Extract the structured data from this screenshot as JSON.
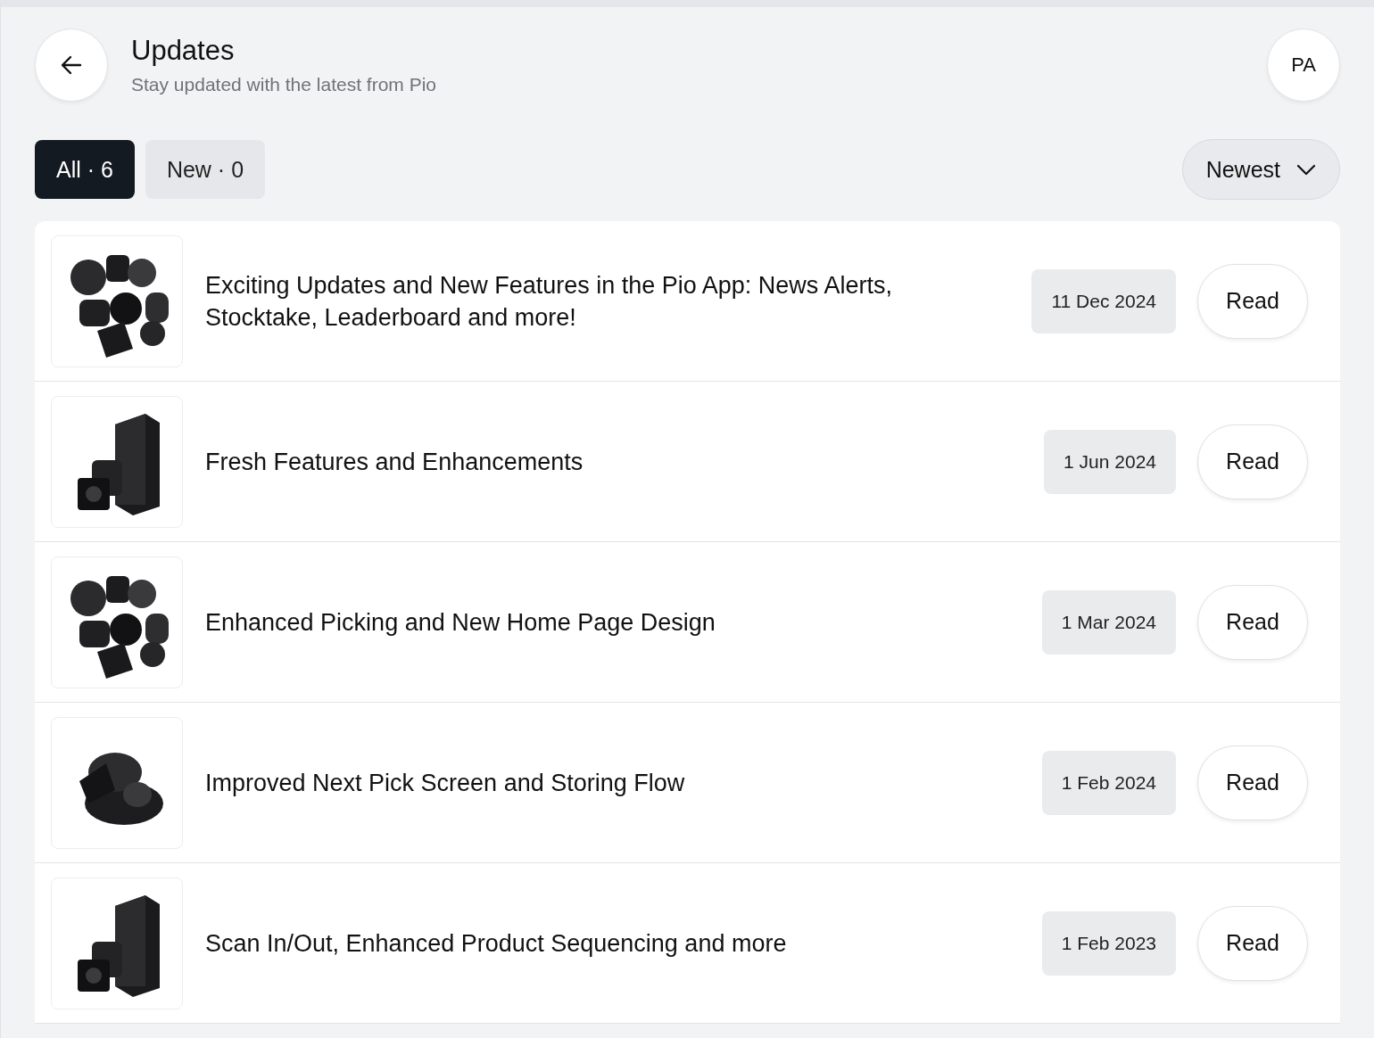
{
  "header": {
    "title": "Updates",
    "subtitle": "Stay updated with the latest from Pio",
    "avatar": "PA"
  },
  "tabs": [
    {
      "label": "All · 6",
      "selected": true
    },
    {
      "label": "New · 0",
      "selected": false
    }
  ],
  "sort": {
    "value": "Newest"
  },
  "updates": [
    {
      "title": "Exciting Updates and New Features in the Pio App: News Alerts, Stocktake, Leaderboard and more!",
      "date": "11 Dec 2024",
      "action": "Read"
    },
    {
      "title": "Fresh Features and Enhancements",
      "date": "1 Jun 2024",
      "action": "Read"
    },
    {
      "title": "Enhanced Picking and New Home Page Design",
      "date": "1 Mar 2024",
      "action": "Read"
    },
    {
      "title": "Improved Next Pick Screen and Storing Flow",
      "date": "1 Feb 2024",
      "action": "Read"
    },
    {
      "title": "Scan In/Out, Enhanced Product Sequencing and more",
      "date": "1 Feb 2023",
      "action": "Read"
    }
  ]
}
